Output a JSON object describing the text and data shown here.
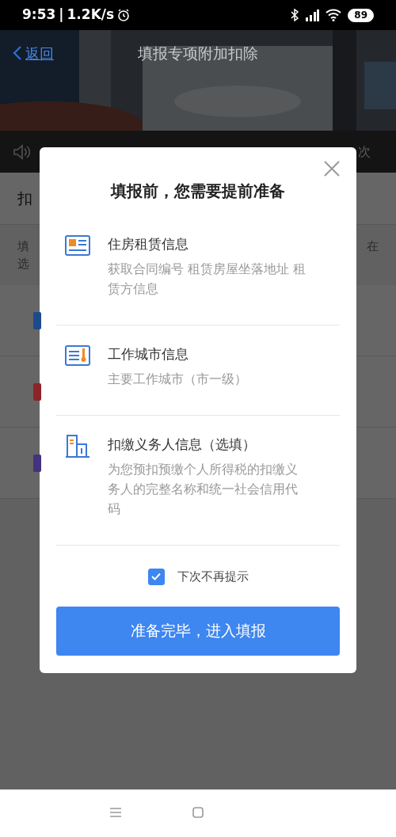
{
  "status_bar": {
    "time": "9:53",
    "separator": "|",
    "speed": "1.2K/s",
    "battery": "89"
  },
  "header": {
    "back": "返回",
    "title": "填报专项附加扣除"
  },
  "notice": {
    "fragment": "次"
  },
  "background": {
    "section_title": "扣",
    "intro_lines": [
      "填",
      "选"
    ],
    "intro_right": "在",
    "rows": [
      {
        "color": "#1d4a8c"
      },
      {
        "color": "#8c2328"
      },
      {
        "color": "#43327d"
      }
    ]
  },
  "dialog": {
    "title": "填报前，您需要提前准备",
    "items": [
      {
        "kind": "rent",
        "title": "住房租赁信息",
        "description": "获取合同编号 租赁房屋坐落地址 租赁方信息"
      },
      {
        "kind": "city",
        "title": "工作城市信息",
        "description": "主要工作城市（市一级）"
      },
      {
        "kind": "employer",
        "title": "扣缴义务人信息（选填）",
        "description": "为您预扣预缴个人所得税的扣缴义务人的完整名称和统一社会信用代码"
      }
    ],
    "dont_show_again": {
      "label": "下次不再提示",
      "checked": true
    },
    "confirm": "准备完毕，进入填报"
  }
}
